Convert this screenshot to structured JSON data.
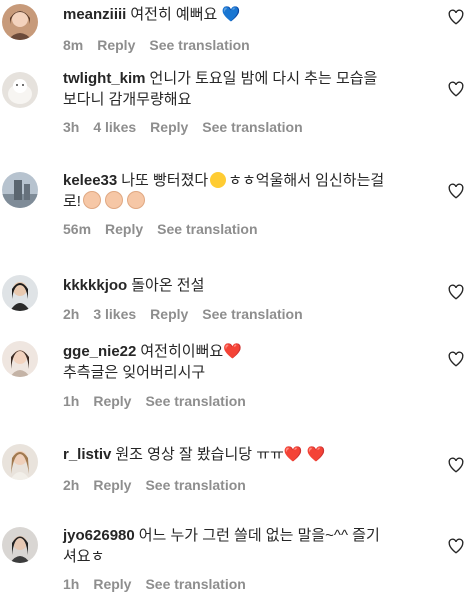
{
  "comments": [
    {
      "username": "meanziiii",
      "text": "여전히 예뻐요",
      "time": "8m",
      "likes": "",
      "reply": "Reply",
      "translate": "See translation"
    },
    {
      "username": "twlight_kim",
      "text": "언니가 토요일 밤에 다시 추는 모습을 보다니 감개무량해요",
      "time": "3h",
      "likes": "4 likes",
      "reply": "Reply",
      "translate": "See translation"
    },
    {
      "username": "kelee33",
      "text": "나또 빵터졌다",
      "text2": "ㅎㅎ억울해서 임신하는걸로!",
      "time": "56m",
      "likes": "",
      "reply": "Reply",
      "translate": "See translation"
    },
    {
      "username": "kkkkkjoo",
      "text": "돌아온 전설",
      "time": "2h",
      "likes": "3 likes",
      "reply": "Reply",
      "translate": "See translation"
    },
    {
      "username": "gge_nie22",
      "text": "여전히이뻐요",
      "text2": "추측글은 잊어버리시구",
      "time": "1h",
      "likes": "",
      "reply": "Reply",
      "translate": "See translation"
    },
    {
      "username": "r_listiv",
      "text": "원조 영상 잘 봤습니당 ㅠㅠ",
      "time": "2h",
      "likes": "",
      "reply": "Reply",
      "translate": "See translation"
    },
    {
      "username": "jyo626980",
      "text": "어느 누가 그런 쓸데 없는 말을~^^ 즐기셔요ㅎ",
      "time": "1h",
      "likes": "",
      "reply": "Reply",
      "translate": "See translation"
    }
  ],
  "colors": {
    "text": "#262626",
    "meta": "#8e8e8e",
    "heart": "#e0245e",
    "blue_heart": "#7ec8f5"
  },
  "icons": {
    "like": "heart-outline-icon"
  }
}
